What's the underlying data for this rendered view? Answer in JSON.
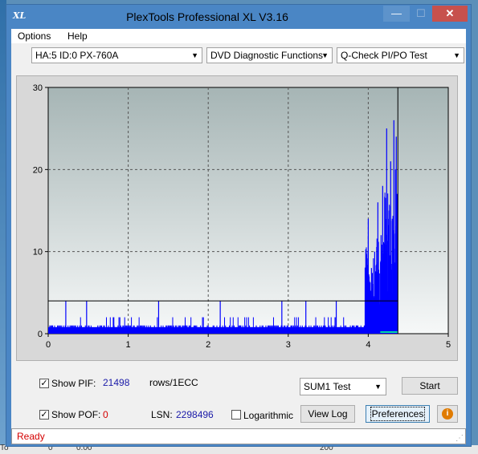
{
  "window": {
    "title": "PlexTools Professional XL V3.16",
    "icon_text": "XL",
    "buttons": {
      "minimize": "—",
      "maximize": "☐",
      "close": "✕"
    }
  },
  "menu": {
    "options": "Options",
    "help": "Help"
  },
  "toolbar": {
    "drive": "HA:5 ID:0  PX-760A",
    "function": "DVD Diagnostic Functions",
    "test": "Q-Check PI/PO Test"
  },
  "chart_data": {
    "type": "bar",
    "xlim": [
      0,
      5
    ],
    "ylim": [
      0,
      30
    ],
    "x_ticks": [
      "0",
      "1",
      "2",
      "3",
      "4",
      "5"
    ],
    "y_ticks": [
      "0",
      "10",
      "20",
      "30"
    ],
    "grid": true,
    "threshold_line": {
      "value": 4,
      "end_x": 4.37
    },
    "end_marker_x": 4.37,
    "series": [
      {
        "color": "#0000ff",
        "baseline": 0.8,
        "spikes": [
          [
            0.05,
            1
          ],
          [
            0.22,
            4
          ],
          [
            0.48,
            4
          ],
          [
            0.62,
            1
          ],
          [
            0.82,
            2
          ],
          [
            1.0,
            1
          ],
          [
            1.38,
            4
          ],
          [
            1.5,
            1
          ],
          [
            1.72,
            1
          ],
          [
            2.15,
            4
          ],
          [
            2.4,
            1
          ],
          [
            2.6,
            1
          ],
          [
            2.92,
            4
          ],
          [
            3.05,
            1
          ],
          [
            3.22,
            4
          ],
          [
            3.45,
            1
          ],
          [
            3.6,
            4
          ],
          [
            3.72,
            1
          ],
          [
            3.85,
            1
          ],
          [
            3.95,
            1
          ],
          [
            4.0,
            14
          ],
          [
            4.04,
            8
          ],
          [
            4.08,
            10
          ],
          [
            4.12,
            16
          ],
          [
            4.16,
            12
          ],
          [
            4.18,
            18
          ],
          [
            4.2,
            11
          ],
          [
            4.23,
            25
          ],
          [
            4.26,
            15
          ],
          [
            4.28,
            21
          ],
          [
            4.3,
            14
          ],
          [
            4.32,
            26
          ],
          [
            4.34,
            20
          ],
          [
            4.35,
            24
          ],
          [
            4.36,
            17
          ]
        ]
      },
      {
        "color": "#00e0a0",
        "baseline": 0.2,
        "x_range": [
          4.15,
          4.37
        ]
      }
    ]
  },
  "controls": {
    "show_pif_label": "Show PIF:",
    "pif_value": "21498",
    "units": "rows/1ECC",
    "show_pof_label": "Show POF:",
    "pof_value": "0",
    "lsn_label": "LSN:",
    "lsn_value": "2298496",
    "logarithmic_label": "Logarithmic",
    "sum_select": "SUM1 Test",
    "start_button": "Start",
    "view_log_button": "View Log",
    "preferences_button": "Preferences",
    "info_button": "i",
    "checkmark": "✓"
  },
  "status": {
    "text": "Ready"
  },
  "background": {
    "left_values": [
      "To",
      "0",
      "0.00",
      "200"
    ]
  }
}
